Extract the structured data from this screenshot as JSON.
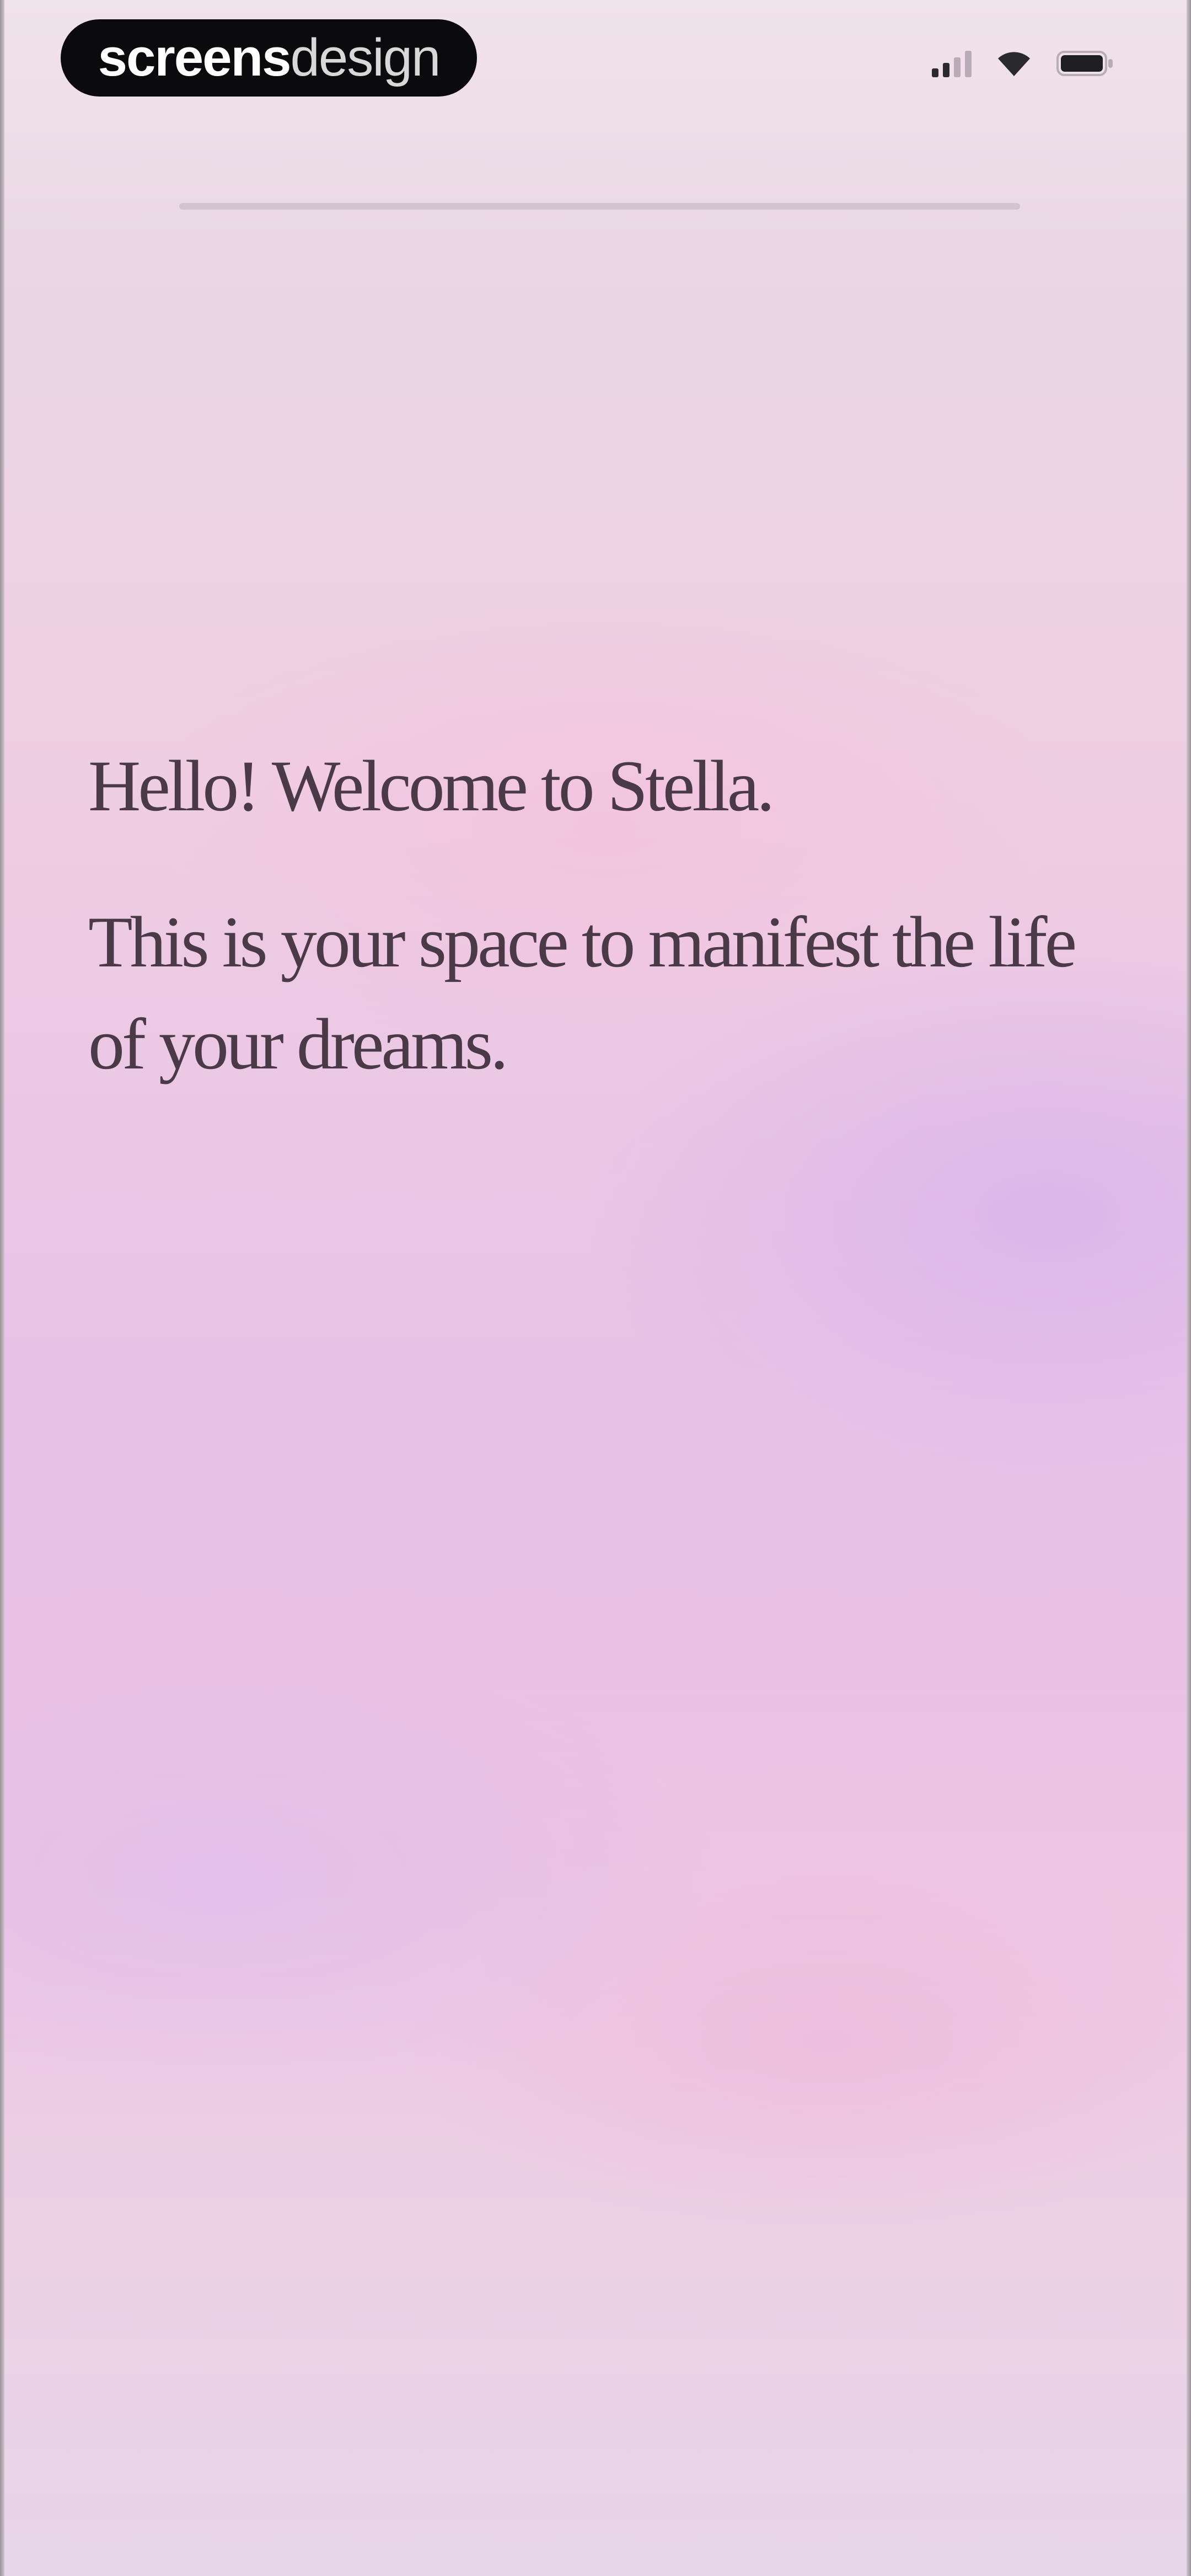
{
  "status_bar": {
    "brand_bold": "screens",
    "brand_light": "design",
    "icons": [
      "signal-icon",
      "wifi-icon",
      "battery-icon"
    ]
  },
  "welcome": {
    "greeting": "Hello! Welcome to Stella.",
    "intro": "This is your space to manifest the life of your dreams."
  },
  "colors": {
    "text": "#4a3a48",
    "pill": "#0b0b0d",
    "bg_top": "#f1e3ec",
    "bg_pink": "#efcfe2",
    "bg_lavender": "#e7c1e8"
  }
}
